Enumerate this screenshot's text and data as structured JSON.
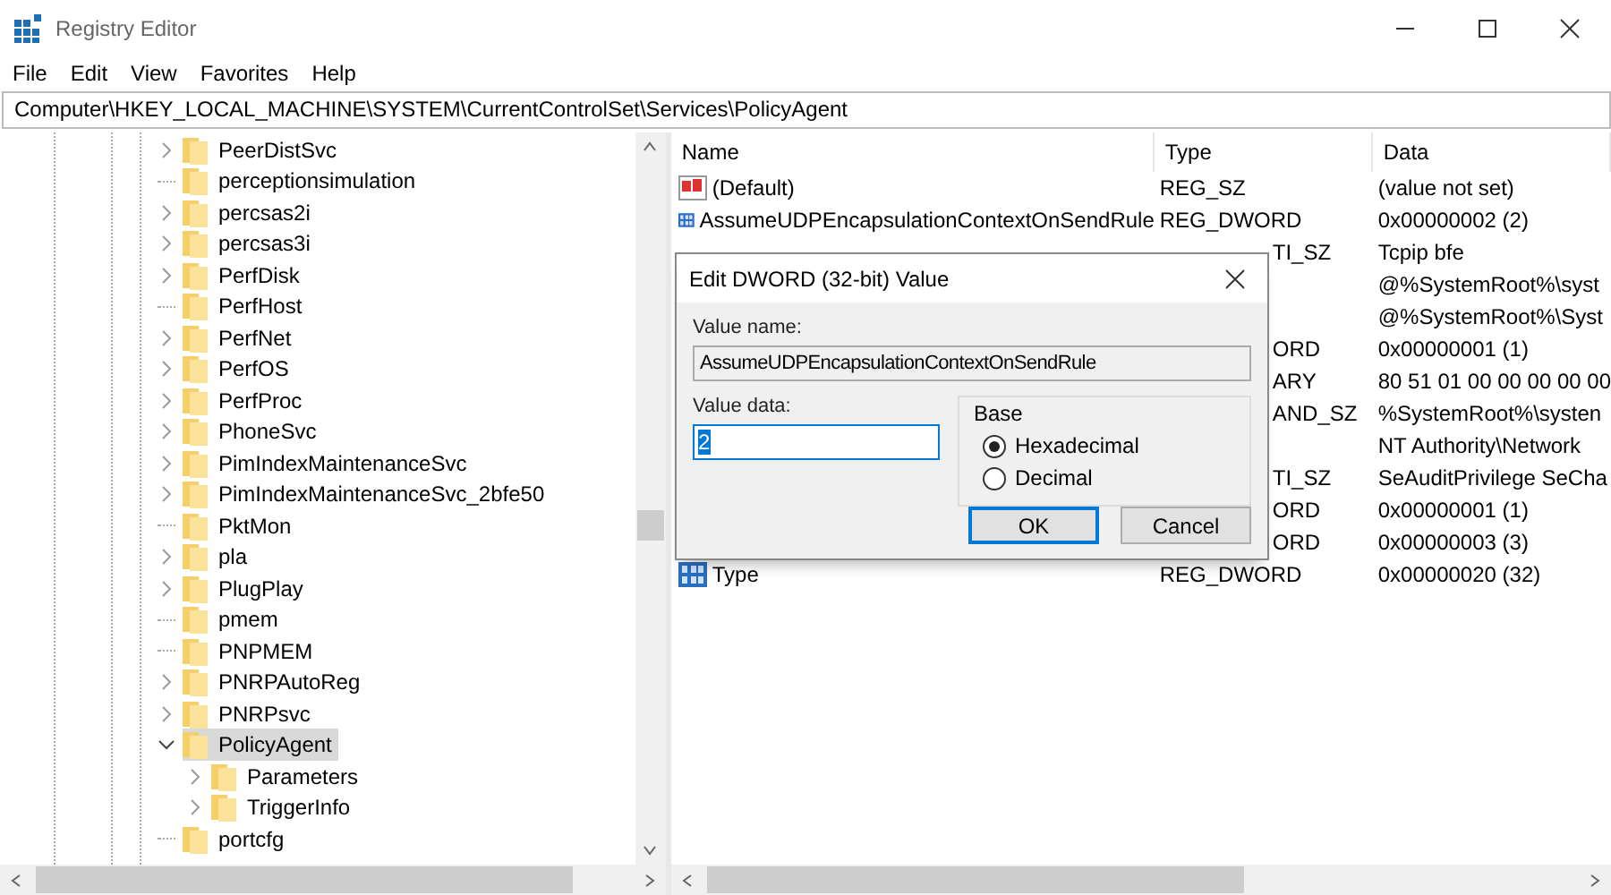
{
  "window": {
    "title": "Registry Editor"
  },
  "menu": [
    "File",
    "Edit",
    "View",
    "Favorites",
    "Help"
  ],
  "address": "Computer\\HKEY_LOCAL_MACHINE\\SYSTEM\\CurrentControlSet\\Services\\PolicyAgent",
  "tree": [
    {
      "label": "PeerDistSvc",
      "kind": "branch",
      "expanded": false,
      "selected": false
    },
    {
      "label": "perceptionsimulation",
      "kind": "leaf",
      "selected": false
    },
    {
      "label": "percsas2i",
      "kind": "branch",
      "expanded": false,
      "selected": false
    },
    {
      "label": "percsas3i",
      "kind": "branch",
      "expanded": false,
      "selected": false
    },
    {
      "label": "PerfDisk",
      "kind": "branch",
      "expanded": false,
      "selected": false
    },
    {
      "label": "PerfHost",
      "kind": "leaf",
      "selected": false
    },
    {
      "label": "PerfNet",
      "kind": "branch",
      "expanded": false,
      "selected": false
    },
    {
      "label": "PerfOS",
      "kind": "branch",
      "expanded": false,
      "selected": false
    },
    {
      "label": "PerfProc",
      "kind": "branch",
      "expanded": false,
      "selected": false
    },
    {
      "label": "PhoneSvc",
      "kind": "branch",
      "expanded": false,
      "selected": false
    },
    {
      "label": "PimIndexMaintenanceSvc",
      "kind": "branch",
      "expanded": false,
      "selected": false
    },
    {
      "label": "PimIndexMaintenanceSvc_2bfe50",
      "kind": "branch",
      "expanded": false,
      "selected": false
    },
    {
      "label": "PktMon",
      "kind": "leaf",
      "selected": false
    },
    {
      "label": "pla",
      "kind": "branch",
      "expanded": false,
      "selected": false
    },
    {
      "label": "PlugPlay",
      "kind": "branch",
      "expanded": false,
      "selected": false
    },
    {
      "label": "pmem",
      "kind": "leaf",
      "selected": false
    },
    {
      "label": "PNPMEM",
      "kind": "leaf",
      "selected": false
    },
    {
      "label": "PNRPAutoReg",
      "kind": "branch",
      "expanded": false,
      "selected": false
    },
    {
      "label": "PNRPsvc",
      "kind": "branch",
      "expanded": false,
      "selected": false
    },
    {
      "label": "PolicyAgent",
      "kind": "branch",
      "expanded": true,
      "selected": true,
      "children": [
        {
          "label": "Parameters",
          "kind": "branch",
          "expanded": false,
          "selected": false
        },
        {
          "label": "TriggerInfo",
          "kind": "branch",
          "expanded": false,
          "selected": false
        }
      ]
    },
    {
      "label": "portcfg",
      "kind": "leaf",
      "selected": false
    }
  ],
  "values": {
    "columns": [
      "Name",
      "Type",
      "Data"
    ],
    "rows": [
      {
        "name": "(Default)",
        "kind": "string",
        "type": "REG_SZ",
        "data": "(value not set)"
      },
      {
        "name": "AssumeUDPEncapsulationContextOnSendRule",
        "kind": "dword",
        "type": "REG_DWORD",
        "data": "0x00000002 (2)"
      },
      {
        "type": "TI_SZ",
        "data": "Tcpip bfe"
      },
      {
        "data": "@%SystemRoot%\\syst"
      },
      {
        "data": "@%SystemRoot%\\Syst"
      },
      {
        "type": "ORD",
        "data": "0x00000001 (1)"
      },
      {
        "type": "ARY",
        "data": "80 51 01 00 00 00 00 00"
      },
      {
        "type": "AND_SZ",
        "data": "%SystemRoot%\\systen"
      },
      {
        "data": "NT Authority\\Network"
      },
      {
        "type": "TI_SZ",
        "data": "SeAuditPrivilege SeCha"
      },
      {
        "type": "ORD",
        "data": "0x00000001 (1)"
      },
      {
        "type": "ORD",
        "data": "0x00000003 (3)"
      },
      {
        "name": "Type",
        "kind": "dword",
        "type": "REG_DWORD",
        "data": "0x00000020 (32)"
      }
    ]
  },
  "dialog": {
    "title": "Edit DWORD (32-bit) Value",
    "value_name_label": "Value name:",
    "value_name": "AssumeUDPEncapsulationContextOnSendRule",
    "value_data_label": "Value data:",
    "value_data": "2",
    "base_label": "Base",
    "bases": [
      {
        "label": "Hexadecimal",
        "selected": true
      },
      {
        "label": "Decimal",
        "selected": false
      }
    ],
    "buttons": [
      {
        "label": "OK",
        "default": true
      },
      {
        "label": "Cancel",
        "default": false
      }
    ]
  }
}
